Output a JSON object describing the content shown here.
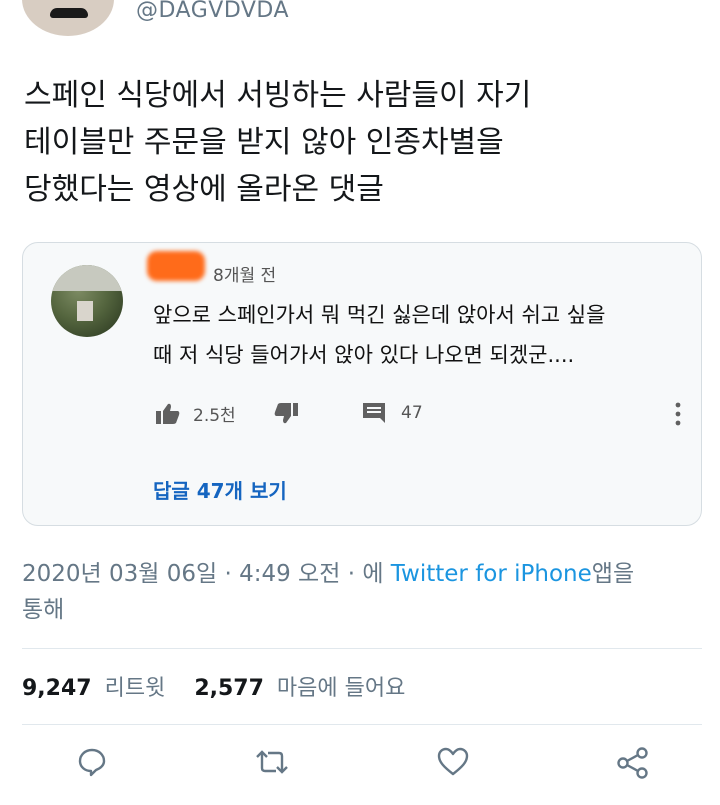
{
  "author": {
    "handle": "@DAGVDVDA"
  },
  "tweet": {
    "lines": [
      "스페인 식당에서 서빙하는 사람들이 자기",
      "테이블만 주문을 받지 않아 인종차별을",
      "당했다는 영상에 올라온 댓글"
    ]
  },
  "comment": {
    "time": "8개월 전",
    "lines": [
      "앞으로 스페인가서 뭐 먹긴 싫은데 앉아서 쉬고 싶을",
      "때 저 식당 들어가서 앉아 있다 나오면 되겠군...."
    ],
    "likes": "2.5천",
    "replies_count": "47",
    "view_replies": "답글 47개 보기",
    "icons": [
      "thumbs-up-icon",
      "thumbs-down-icon",
      "comment-icon",
      "more-vertical-icon"
    ]
  },
  "meta": {
    "date": "2020년 03월 06일 · 4:49 오전 · 에",
    "source": "Twitter for iPhone",
    "suffix": "앱을",
    "line2": "통해"
  },
  "stats": {
    "retweets": "9,247",
    "retweets_label": "리트윗",
    "likes": "2,577",
    "likes_label": "마음에 들어요"
  },
  "actions": {
    "icons": [
      "reply-icon",
      "retweet-icon",
      "like-icon",
      "share-icon"
    ]
  },
  "colors": {
    "link": "#1b95e0",
    "reply_link": "#1565c0",
    "muted": "#657786"
  }
}
